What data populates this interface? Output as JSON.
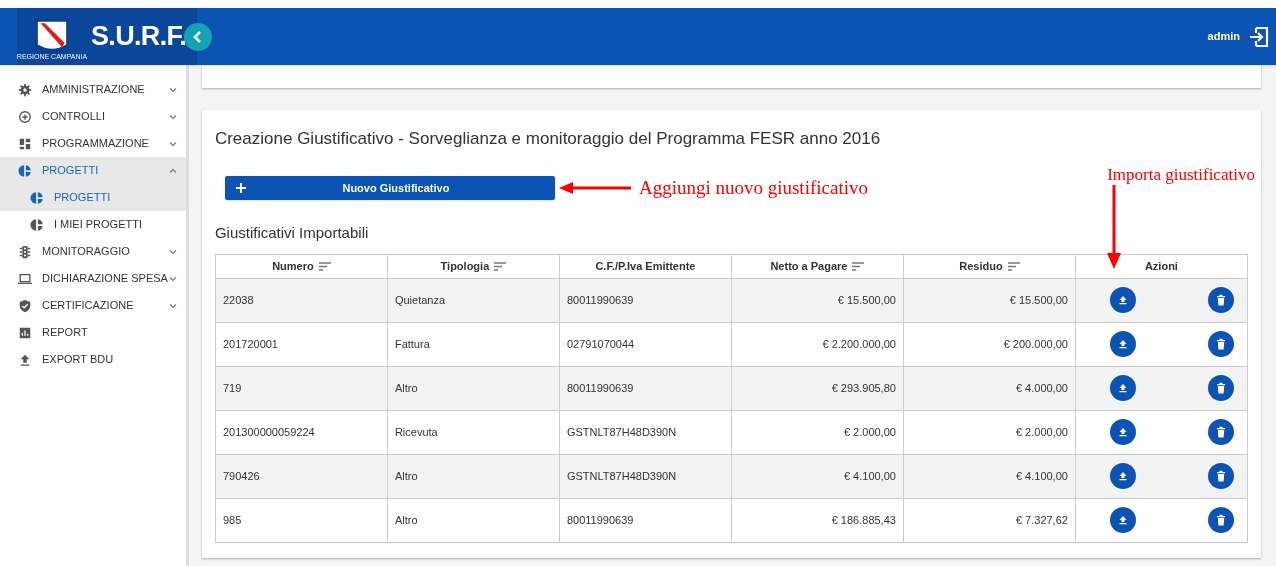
{
  "header": {
    "logo_caption": "REGIONE CAMPANIA",
    "app_name": "S.U.R.F.",
    "user": "admin"
  },
  "sidebar": {
    "items": [
      {
        "label": "AMMINISTRAZIONE",
        "expanded": false,
        "selected": false
      },
      {
        "label": "CONTROLLI",
        "expanded": false,
        "selected": false
      },
      {
        "label": "PROGRAMMAZIONE",
        "expanded": false,
        "selected": false
      },
      {
        "label": "PROGETTI",
        "expanded": true,
        "selected": true,
        "children": [
          {
            "label": "PROGETTI",
            "selected": true
          },
          {
            "label": "I MIEI PROGETTI",
            "selected": false
          }
        ]
      },
      {
        "label": "MONITORAGGIO",
        "expanded": false,
        "selected": false
      },
      {
        "label": "DICHIARAZIONE SPESA",
        "expanded": false,
        "selected": false
      },
      {
        "label": "CERTIFICAZIONE",
        "expanded": false,
        "selected": false
      },
      {
        "label": "REPORT",
        "selected": false
      },
      {
        "label": "EXPORT BDU",
        "selected": false
      }
    ]
  },
  "card": {
    "title": "Creazione Giustificativo - Sorveglianza e monitoraggio del Programma FESR anno 2016",
    "new_button": "Nuovo Giustificativo",
    "table_title": "Giustificativi Importabili",
    "table": {
      "columns": [
        {
          "label": "Numero",
          "sortable": true
        },
        {
          "label": "Tipologia",
          "sortable": true
        },
        {
          "label": "C.F./P.Iva Emittente",
          "sortable": false
        },
        {
          "label": "Netto a Pagare",
          "sortable": true
        },
        {
          "label": "Residuo",
          "sortable": true
        },
        {
          "label": "Azioni",
          "sortable": false
        }
      ],
      "rows": [
        [
          "22038",
          "Quietanza",
          "80011990639",
          "€ 15.500,00",
          "€ 15.500,00"
        ],
        [
          "201720001",
          "Fattura",
          "02791070044",
          "€ 2.200.000,00",
          "€ 200.000,00"
        ],
        [
          "719",
          "Altro",
          "80011990639",
          "€ 293.905,80",
          "€ 4.000,00"
        ],
        [
          "201300000059224",
          "Ricevuta",
          "GSTNLT87H48D390N",
          "€ 2.000,00",
          "€ 2.000,00"
        ],
        [
          "790426",
          "Altro",
          "GSTNLT87H48D390N",
          "€ 4.100,00",
          "€ 4.100,00"
        ],
        [
          "985",
          "Altro",
          "80011990639",
          "€ 186.885,43",
          "€ 7.327,62"
        ]
      ]
    }
  },
  "annotations": [
    "Aggiungi nuovo giustificativo",
    "Importa giustificativo"
  ]
}
